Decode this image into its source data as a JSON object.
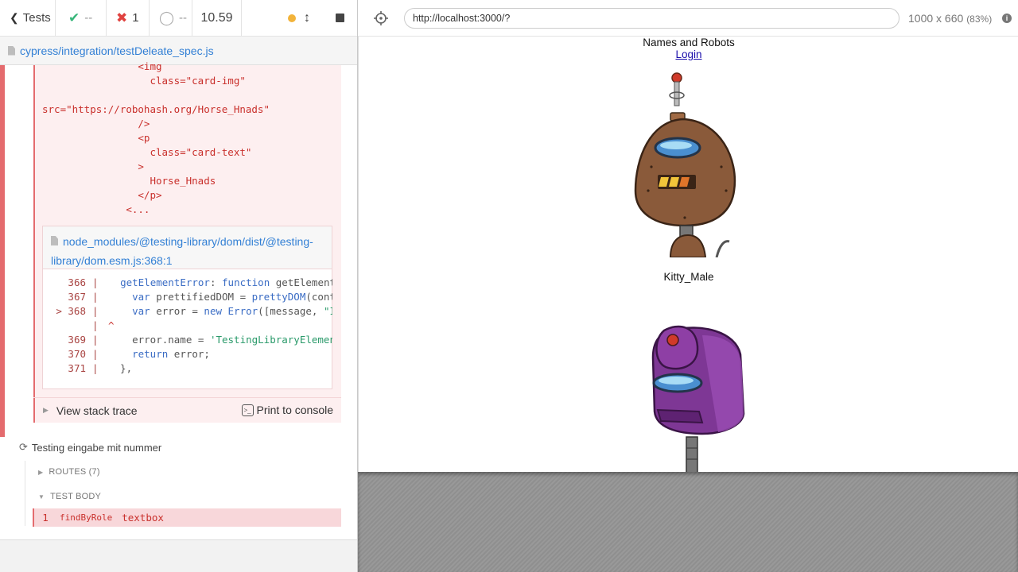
{
  "reporter": {
    "tests_label": "Tests",
    "passed": "--",
    "failed": "1",
    "pending": "--",
    "duration": "10.59",
    "spec_path": "cypress/integration/testDeleate_spec.js"
  },
  "error": {
    "dom_snippet": [
      "                <img",
      "                  class=\"card-img\"",
      "",
      "src=\"https://robohash.org/Horse_Hnads\"",
      "                />",
      "                <p",
      "                  class=\"card-text\"",
      "                >",
      "                  Horse_Hnads",
      "                </p>",
      "              <..."
    ],
    "source_file": "node_modules/@testing-library/dom/dist/@testing-library/dom.esm.js:368:1",
    "code_lines": [
      {
        "num": "366",
        "code": "  getElementError: function getElement"
      },
      {
        "num": "367",
        "code": "    var prettifiedDOM = prettyDOM(cont"
      },
      {
        "num": "> 368",
        "code": "    var error = new Error([message, \"I"
      },
      {
        "num": "",
        "code": "^"
      },
      {
        "num": "369",
        "code": "    error.name = 'TestingLibraryElemen"
      },
      {
        "num": "370",
        "code": "    return error;"
      },
      {
        "num": "371",
        "code": "  },"
      }
    ],
    "view_stack_trace": "View stack trace",
    "print_to_console": "Print to console"
  },
  "test": {
    "title": "Testing eingabe mit nummer",
    "routes": "ROUTES (7)",
    "test_body": "TEST BODY",
    "command_num": "1",
    "command_name": "findByRole",
    "command_arg": "textbox"
  },
  "aut": {
    "url": "http://localhost:3000/?",
    "viewport": "1000 x 660",
    "scale": "(83%)",
    "info": "i"
  },
  "app": {
    "title": "Names and Robots",
    "login": "Login",
    "cards": [
      {
        "name": "Kitty_Male",
        "robot_color": "#8a5a3a"
      },
      {
        "name": "",
        "robot_color": "#8e3fa5"
      }
    ]
  },
  "icons": {
    "back": "chevron-left-icon",
    "passed": "check-icon",
    "failed": "x-icon",
    "pending": "circle-icon",
    "running": "dot-icon",
    "scroll": "arrows-vertical-icon",
    "stop": "stop-icon",
    "file": "file-icon",
    "selector": "crosshair-icon",
    "sync": "sync-icon",
    "terminal": "terminal-icon"
  },
  "colors": {
    "pass": "#37b67a",
    "fail": "#e0423f",
    "accent": "#3380d5",
    "error_bg": "#fdeff0"
  }
}
